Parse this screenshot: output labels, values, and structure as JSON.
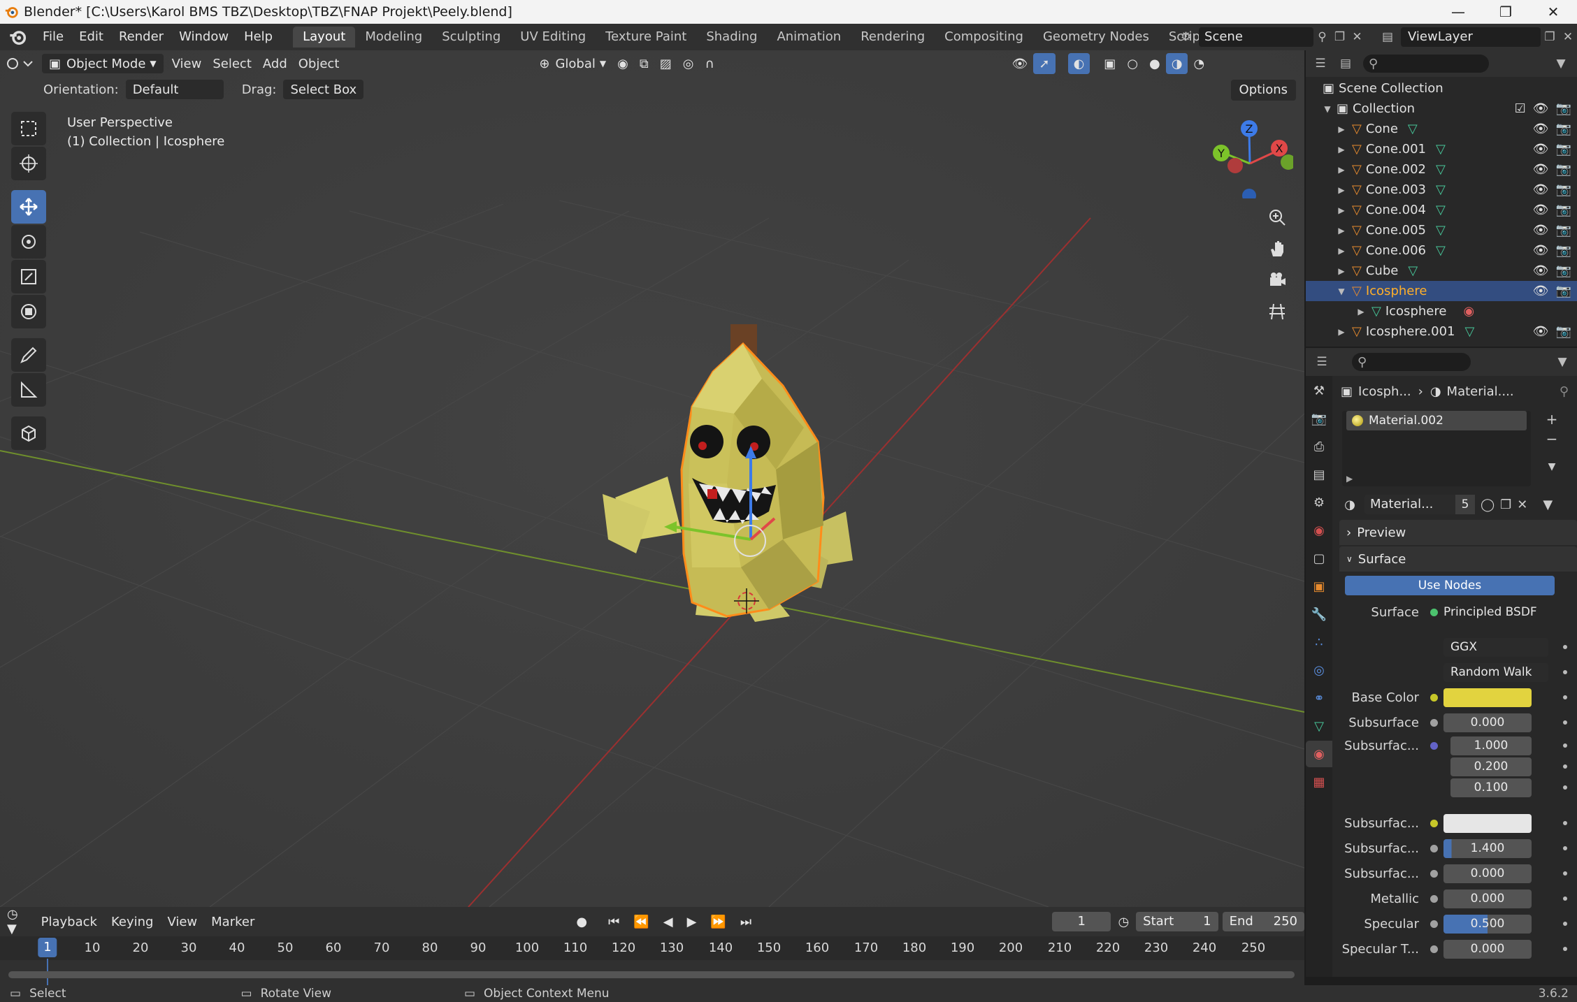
{
  "window": {
    "title": "Blender* [C:\\Users\\Karol BMS TBZ\\Desktop\\TBZ\\FNAP Projekt\\Peely.blend]",
    "minimize": "—",
    "maximize": "❐",
    "close": "✕"
  },
  "menu": {
    "items": [
      "File",
      "Edit",
      "Render",
      "Window",
      "Help"
    ]
  },
  "workspaces": {
    "tabs": [
      "Layout",
      "Modeling",
      "Sculpting",
      "UV Editing",
      "Texture Paint",
      "Shading",
      "Animation",
      "Rendering",
      "Compositing",
      "Geometry Nodes",
      "Scripting"
    ],
    "active": "Layout",
    "add": "+"
  },
  "scene": {
    "name": "Scene"
  },
  "view_layer": {
    "name": "ViewLayer"
  },
  "viewport": {
    "mode": "Object Mode",
    "menus": [
      "View",
      "Select",
      "Add",
      "Object"
    ],
    "transform_orientation": "Global",
    "orientation_label": "Orientation:",
    "orientation_value": "Default",
    "drag_label": "Drag:",
    "drag_value": "Select Box",
    "options": "Options",
    "info_line1": "User Perspective",
    "info_line2": "(1) Collection | Icosphere",
    "gizmo": {
      "z": "Z",
      "y": "Y",
      "x": "X"
    }
  },
  "outliner": {
    "scene_collection": "Scene Collection",
    "collection": "Collection",
    "items": [
      {
        "name": "Cone"
      },
      {
        "name": "Cone.001"
      },
      {
        "name": "Cone.002"
      },
      {
        "name": "Cone.003"
      },
      {
        "name": "Cone.004"
      },
      {
        "name": "Cone.005"
      },
      {
        "name": "Cone.006"
      },
      {
        "name": "Cube"
      },
      {
        "name": "Icosphere"
      },
      {
        "name": "Icosphere"
      },
      {
        "name": "Icosphere.001"
      }
    ]
  },
  "properties": {
    "breadcrumb_object": "Icosph...",
    "breadcrumb_material": "Material....",
    "slot": "Material.002",
    "material_name": "Material...",
    "material_users": "5",
    "preview_panel": "Preview",
    "surface_panel": "Surface",
    "use_nodes": "Use Nodes",
    "fields": [
      {
        "label": "Surface",
        "value": "Principled BSDF"
      },
      {
        "label": "",
        "value": "GGX"
      },
      {
        "label": "",
        "value": "Random Walk"
      },
      {
        "label": "Base Color",
        "value": ""
      },
      {
        "label": "Subsurface",
        "value": "0.000"
      },
      {
        "label": "Subsurfac...",
        "value": "1.000"
      },
      {
        "label": "",
        "value": "0.200"
      },
      {
        "label": "",
        "value": "0.100"
      },
      {
        "label": "Subsurfac...",
        "value": ""
      },
      {
        "label": "Subsurfac...",
        "value": "1.400"
      },
      {
        "label": "Subsurfac...",
        "value": "0.000"
      },
      {
        "label": "Metallic",
        "value": "0.000"
      },
      {
        "label": "Specular",
        "value": "0.500"
      },
      {
        "label": "Specular T...",
        "value": "0.000"
      }
    ],
    "base_color": "#e2d33f",
    "subsurface_color": "#e6e6e6"
  },
  "timeline": {
    "menus": [
      "Playback",
      "Keying",
      "View",
      "Marker"
    ],
    "current_frame": "1",
    "start_label": "Start",
    "start": "1",
    "end_label": "End",
    "end": "250",
    "ticks": [
      "10",
      "20",
      "30",
      "40",
      "50",
      "60",
      "70",
      "80",
      "90",
      "100",
      "110",
      "120",
      "130",
      "140",
      "150",
      "160",
      "170",
      "180",
      "190",
      "200",
      "210",
      "220",
      "230",
      "240",
      "250"
    ],
    "playhead": "1"
  },
  "status": {
    "select": "Select",
    "rotate": "Rotate View",
    "context": "Object Context Menu",
    "version": "3.6.2"
  },
  "colors": {
    "accent": "#4772b3",
    "selection_orange": "#ffaf29"
  }
}
